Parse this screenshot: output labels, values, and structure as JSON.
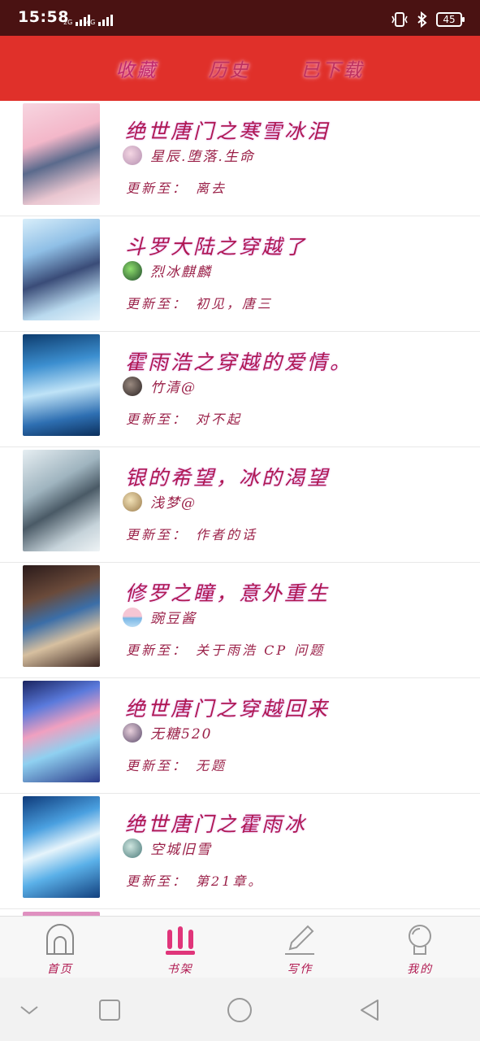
{
  "status": {
    "time": "15:58",
    "signal1_label": "2G",
    "signal2_label": "4G",
    "battery": "45"
  },
  "header": {
    "tabs": [
      {
        "label": "收藏"
      },
      {
        "label": "历史"
      },
      {
        "label": "已下载"
      }
    ]
  },
  "colors": {
    "header_bg": "#e0302a",
    "status_bg": "#4a1212",
    "text_accent": "#b01850"
  },
  "update_prefix": "更新至：",
  "books": [
    {
      "title": "绝世唐门之寒雪冰泪",
      "author": "星辰.堕落.生命",
      "update": "离去"
    },
    {
      "title": "斗罗大陆之穿越了",
      "author": "烈冰麒麟",
      "update": "初见，唐三"
    },
    {
      "title": "霍雨浩之穿越的爱情。",
      "author": "竹清@",
      "update": "对不起"
    },
    {
      "title": "银的希望，冰的渴望",
      "author": "浅梦@",
      "update": "作者的话"
    },
    {
      "title": "修罗之瞳，意外重生",
      "author": "豌豆酱",
      "update": "关于雨浩 CP 问题"
    },
    {
      "title": "绝世唐门之穿越回来",
      "author": "无糖520",
      "update": "无题"
    },
    {
      "title": "绝世唐门之霍雨冰",
      "author": "空城旧雪",
      "update": "第21章。"
    }
  ],
  "bottom_nav": [
    {
      "label": "首页",
      "icon": "home-icon"
    },
    {
      "label": "书架",
      "icon": "bookshelf-icon"
    },
    {
      "label": "写作",
      "icon": "pencil-icon"
    },
    {
      "label": "我的",
      "icon": "profile-icon"
    }
  ]
}
